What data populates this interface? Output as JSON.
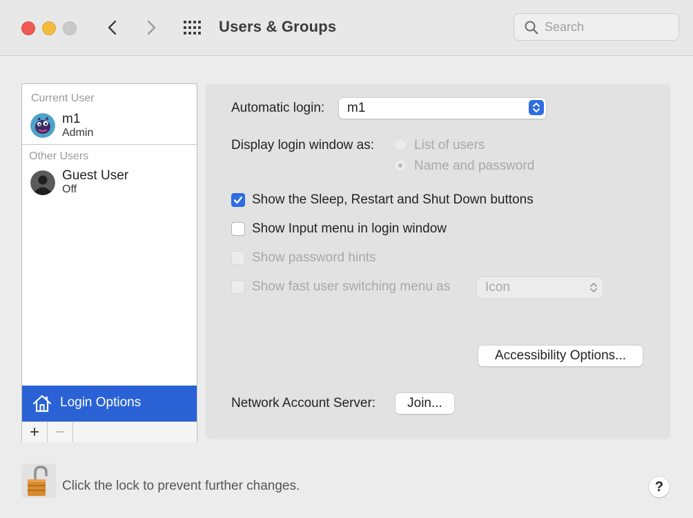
{
  "window": {
    "title": "Users & Groups",
    "search": {
      "placeholder": "Search",
      "value": ""
    }
  },
  "sidebar": {
    "current_user_label": "Current User",
    "current_user": {
      "name": "m1",
      "role": "Admin"
    },
    "other_users_label": "Other Users",
    "other_users": [
      {
        "name": "Guest User",
        "status": "Off"
      }
    ],
    "login_options_label": "Login Options",
    "add_label": "+",
    "remove_label": "−"
  },
  "main": {
    "automatic_login_label": "Automatic login:",
    "automatic_login_value": "m1",
    "display_login_label": "Display login window as:",
    "display_options": [
      {
        "label": "List of users",
        "selected": false
      },
      {
        "label": "Name and password",
        "selected": true
      }
    ],
    "checkboxes": [
      {
        "label": "Show the Sleep, Restart and Shut Down buttons",
        "checked": true,
        "enabled": true
      },
      {
        "label": "Show Input menu in login window",
        "checked": false,
        "enabled": true
      },
      {
        "label": "Show password hints",
        "checked": false,
        "enabled": false
      },
      {
        "label": "Show fast user switching menu as",
        "checked": false,
        "enabled": false
      }
    ],
    "fast_switch_value": "Icon",
    "accessibility_button": "Accessibility Options...",
    "network_server_label": "Network Account Server:",
    "join_button": "Join..."
  },
  "footer": {
    "lock_text": "Click the lock to prevent further changes.",
    "help_label": "?"
  },
  "colors": {
    "accent": "#2a62d6",
    "close": "#ee5a52",
    "minimize": "#f3bb3e",
    "zoom_disabled": "#c9c9c9"
  },
  "icons": {
    "traffic_lights": [
      "close-icon",
      "minimize-icon",
      "zoom-icon"
    ],
    "nav": [
      "chevron-left-icon",
      "chevron-right-icon"
    ],
    "grid": "grid-icon",
    "search": "search-icon",
    "login_options": "house-icon",
    "lock": "unlocked-padlock-icon",
    "help": "question-icon"
  }
}
